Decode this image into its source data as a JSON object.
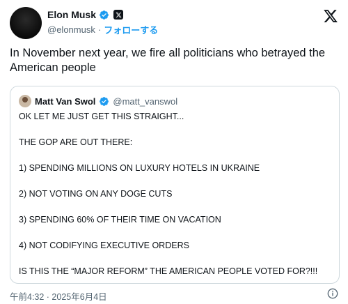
{
  "author": {
    "name": "Elon Musk",
    "handle": "@elonmusk",
    "separator": "·",
    "follow_label": "フォローする"
  },
  "tweet": {
    "text": "In November next year, we fire all politicians who betrayed the American people"
  },
  "quoted": {
    "name": "Matt Van Swol",
    "handle": "@matt_vanswol",
    "lines": [
      "OK LET ME JUST GET THIS STRAIGHT...",
      "THE GOP ARE OUT THERE:",
      "1) SPENDING MILLIONS ON LUXURY HOTELS IN UKRAINE",
      "2) NOT VOTING ON ANY DOGE CUTS",
      "3) SPENDING 60% OF THEIR TIME ON VACATION",
      "4) NOT CODIFYING EXECUTIVE ORDERS",
      "IS THIS THE “MAJOR REFORM” THE AMERICAN PEOPLE VOTED FOR?!!!"
    ]
  },
  "timestamp": "午前4:32 · 2025年6月4日",
  "icons": {
    "verified": "verified-badge-icon",
    "affiliate": "x-affiliate-icon",
    "logo": "x-logo-icon",
    "info": "info-icon"
  },
  "colors": {
    "accent": "#1d9bf0",
    "text": "#0f1419",
    "muted": "#536471",
    "border": "#cfd9de"
  }
}
